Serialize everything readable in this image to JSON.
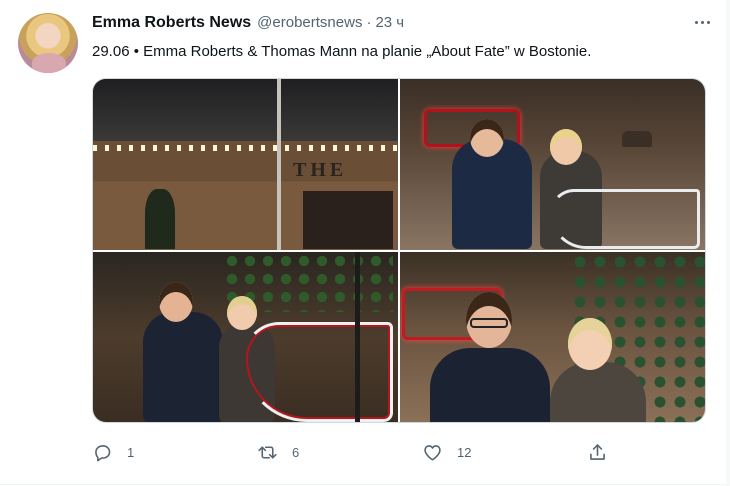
{
  "tweet": {
    "author_name": "Emma Roberts News",
    "handle": "@erobertsnews",
    "separator": "·",
    "time": "23 ч",
    "text": "29.06 • Emma Roberts & Thomas Mann na planie „About Fate” w Bostonie."
  },
  "media": {
    "photo1_sign": "THE"
  },
  "actions": {
    "reply_count": "1",
    "retweet_count": "6",
    "like_count": "12"
  },
  "icons": {
    "more": "more-horizontal-icon",
    "reply": "reply-icon",
    "retweet": "retweet-icon",
    "like": "heart-icon",
    "share": "share-icon"
  },
  "colors": {
    "text_primary": "#0f1419",
    "text_secondary": "#536471",
    "border": "#cfd9de"
  }
}
